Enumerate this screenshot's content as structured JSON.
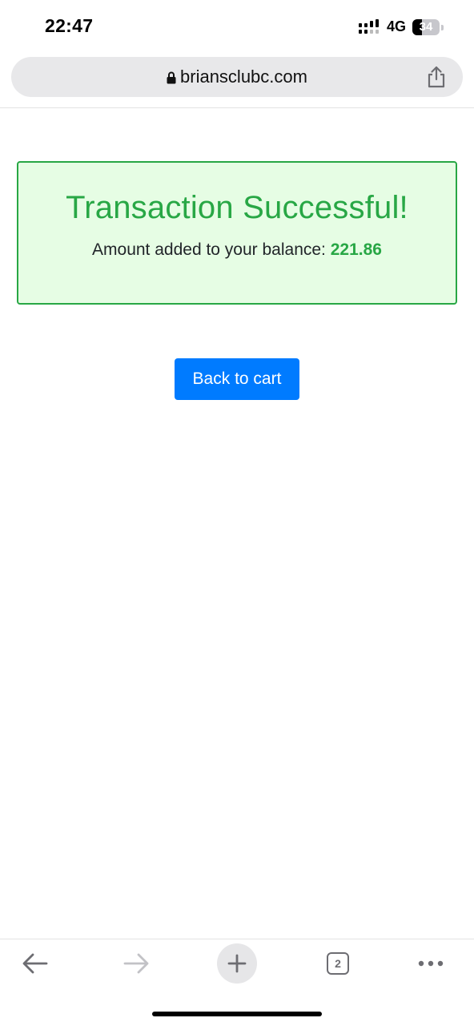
{
  "status_bar": {
    "time": "22:47",
    "network": "4G",
    "battery_level": "34",
    "battery_fraction": 0.34
  },
  "browser": {
    "url": "briansclubc.com",
    "tab_count": "2",
    "icons": {
      "lock": "lock-icon",
      "share": "share-icon",
      "back": "arrow-left-icon",
      "forward": "arrow-right-icon",
      "new_tab": "plus-icon",
      "more": "more-icon"
    }
  },
  "page": {
    "success_title": "Transaction Successful!",
    "message_prefix": "Amount added to your balance:",
    "amount": "221.86",
    "back_button_label": "Back to cart"
  },
  "colors": {
    "success": "#28a745",
    "success_bg": "#e6fde4",
    "primary": "#007bff",
    "toolbar_icon": "#6d6d72"
  }
}
